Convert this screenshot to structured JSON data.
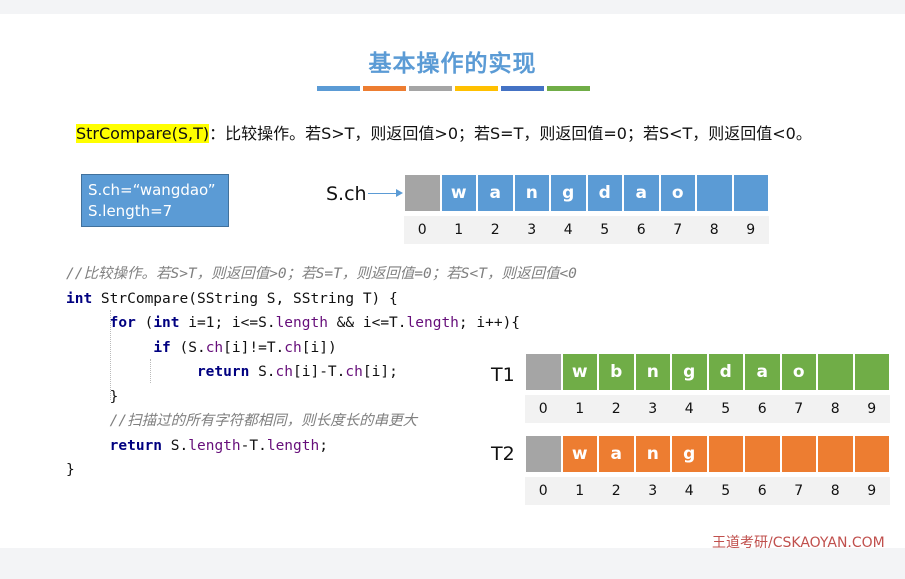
{
  "title": "基本操作的实现",
  "stripes": [
    "#5b9bd5",
    "#ed7d31",
    "#a5a5a5",
    "#ffc000",
    "#4472c4",
    "#70ad47"
  ],
  "description": {
    "func": "StrCompare(S,T)",
    "rest": "：比较操作。若S>T，则返回值>0；若S=T，则返回值=0；若S<T，则返回值<0。"
  },
  "infobox": {
    "line1": "S.ch=“wangdao”",
    "line2": "S.length=7"
  },
  "arrays": {
    "S": {
      "label": "S.ch",
      "color": "#5b9bd5",
      "cells": [
        "",
        "w",
        "a",
        "n",
        "g",
        "d",
        "a",
        "o",
        "",
        ""
      ]
    },
    "T1": {
      "label": "T1",
      "color": "#70ad47",
      "cells": [
        "",
        "w",
        "b",
        "n",
        "g",
        "d",
        "a",
        "o",
        "",
        ""
      ]
    },
    "T2": {
      "label": "T2",
      "color": "#ed7d31",
      "cells": [
        "",
        "w",
        "a",
        "n",
        "g",
        "",
        "",
        "",
        "",
        ""
      ]
    },
    "indices": [
      "0",
      "1",
      "2",
      "3",
      "4",
      "5",
      "6",
      "7",
      "8",
      "9"
    ],
    "unused_color": "#a5a5a5"
  },
  "code": {
    "comment1": "//比较操作。若S>T，则返回值>0；若S=T，则返回值=0；若S<T，则返回值<0",
    "kw_int": "int",
    "sig": " StrCompare(SString S, SString T) {",
    "kw_for": "for",
    "for_mid1": " (",
    "for_int": "int",
    "for_mid2": " i=1; i<=S.",
    "for_len1": "length",
    "for_mid3": " && i<=T.",
    "for_len2": "length",
    "for_end": "; i++){",
    "kw_if": "if",
    "if_a": " (S.",
    "if_ch1": "ch",
    "if_b": "[i]!=T.",
    "if_ch2": "ch",
    "if_c": "[i])",
    "kw_return1": "return",
    "ret1_a": " S.",
    "ret1_ch1": "ch",
    "ret1_b": "[i]-T.",
    "ret1_ch2": "ch",
    "ret1_c": "[i];",
    "close_inner": "}",
    "comment2": "//扫描过的所有字符都相同，则长度长的串更大",
    "kw_return2": "return",
    "ret2_a": " S.",
    "ret2_len1": "length",
    "ret2_b": "-T.",
    "ret2_len2": "length",
    "ret2_c": ";",
    "close_outer": "}"
  },
  "brand": "王道考研/CSKAOYAN.COM"
}
